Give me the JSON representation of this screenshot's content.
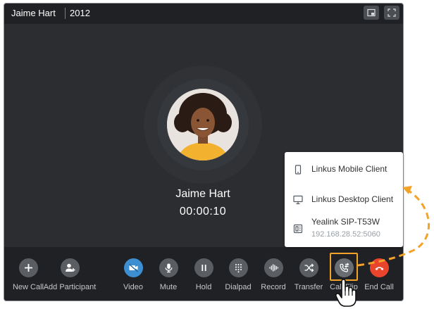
{
  "titlebar": {
    "caller": "Jaime Hart",
    "extension": "2012",
    "buttons": [
      {
        "name": "picture-in-picture-button",
        "icon": "picture-in-picture-icon"
      },
      {
        "name": "fullscreen-button",
        "icon": "fullscreen-icon"
      }
    ]
  },
  "call": {
    "name": "Jaime Hart",
    "timer": "00:00:10"
  },
  "controls": [
    {
      "id": "new-call",
      "label": "New Call",
      "icon": "plus-icon"
    },
    {
      "id": "add-participant",
      "label": "Add Participant",
      "icon": "add-person-icon"
    },
    {
      "id": "video",
      "label": "Video",
      "icon": "video-off-icon",
      "accent": "#3d8fd1"
    },
    {
      "id": "mute",
      "label": "Mute",
      "icon": "microphone-icon"
    },
    {
      "id": "hold",
      "label": "Hold",
      "icon": "pause-icon"
    },
    {
      "id": "dialpad",
      "label": "Dialpad",
      "icon": "dialpad-icon"
    },
    {
      "id": "record",
      "label": "Record",
      "icon": "waveform-icon"
    },
    {
      "id": "transfer",
      "label": "Transfer",
      "icon": "shuffle-icon"
    },
    {
      "id": "call-flip",
      "label": "Call Flip",
      "icon": "phone-flip-icon"
    },
    {
      "id": "end-call",
      "label": "End Call",
      "icon": "hangup-icon",
      "accent": "#e8452c"
    }
  ],
  "call_flip_menu": {
    "devices": [
      {
        "name": "Linkus Mobile Client",
        "icon": "mobile-icon"
      },
      {
        "name": "Linkus Desktop Client",
        "icon": "desktop-icon"
      },
      {
        "name": "Yealink SIP-T53W",
        "address": "192.168.28.52:5060",
        "icon": "desk-phone-icon"
      }
    ]
  },
  "colors": {
    "window_bg": "#2b2d30",
    "bar_bg": "#1f2124",
    "highlight": "#f3a32a",
    "end_call": "#e8452c",
    "video_off": "#3d8fd1"
  }
}
